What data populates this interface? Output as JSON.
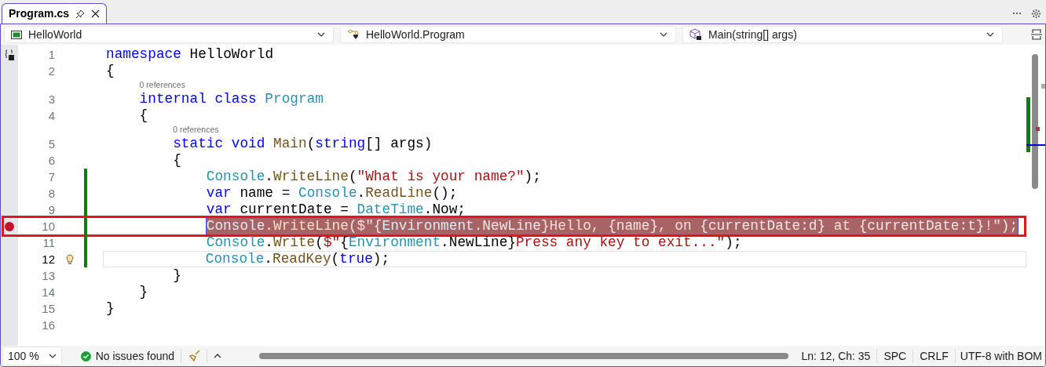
{
  "tab": {
    "title": "Program.cs",
    "selected": true
  },
  "nav": [
    {
      "kind": "project",
      "label": "HelloWorld"
    },
    {
      "kind": "class",
      "label": "HelloWorld.Program"
    },
    {
      "kind": "method",
      "label": "Main(string[] args)"
    }
  ],
  "lines": [
    {
      "number": "1",
      "breakpoint": false,
      "changed": false,
      "selected": false,
      "current": false,
      "framed": false,
      "lightbulb": false,
      "tokens": [
        {
          "kind": "keyword",
          "text": "namespace"
        },
        {
          "kind": "plain",
          "text": " HelloWorld"
        }
      ]
    },
    {
      "number": "2",
      "breakpoint": false,
      "changed": false,
      "selected": false,
      "current": false,
      "framed": false,
      "lightbulb": false,
      "tokens": [
        {
          "kind": "plain",
          "text": "{"
        }
      ]
    },
    {
      "number": "3",
      "codelens": "0 references",
      "breakpoint": false,
      "changed": false,
      "selected": false,
      "current": false,
      "framed": false,
      "lightbulb": false,
      "tokens": [
        {
          "kind": "keyword",
          "text": "    internal class"
        },
        {
          "kind": "type",
          "text": " Program"
        }
      ]
    },
    {
      "number": "4",
      "breakpoint": false,
      "changed": false,
      "selected": false,
      "current": false,
      "framed": false,
      "lightbulb": false,
      "tokens": [
        {
          "kind": "plain",
          "text": "    {"
        }
      ]
    },
    {
      "number": "5",
      "codelens": "0 references",
      "breakpoint": false,
      "changed": false,
      "selected": false,
      "current": false,
      "framed": false,
      "lightbulb": false,
      "tokens": [
        {
          "kind": "keyword",
          "text": "        static void"
        },
        {
          "kind": "method",
          "text": " Main"
        },
        {
          "kind": "plain",
          "text": "("
        },
        {
          "kind": "keyword",
          "text": "string"
        },
        {
          "kind": "plain",
          "text": "[] args)"
        }
      ]
    },
    {
      "number": "6",
      "breakpoint": false,
      "changed": false,
      "selected": false,
      "current": false,
      "framed": false,
      "lightbulb": false,
      "tokens": [
        {
          "kind": "plain",
          "text": "        {"
        }
      ]
    },
    {
      "number": "7",
      "breakpoint": false,
      "changed": true,
      "selected": false,
      "current": false,
      "framed": false,
      "lightbulb": false,
      "tokens": [
        {
          "kind": "type",
          "text": "            Console"
        },
        {
          "kind": "plain",
          "text": "."
        },
        {
          "kind": "method",
          "text": "WriteLine"
        },
        {
          "kind": "plain",
          "text": "("
        },
        {
          "kind": "string",
          "text": "\"What is your name?\""
        },
        {
          "kind": "plain",
          "text": ");"
        }
      ]
    },
    {
      "number": "8",
      "breakpoint": false,
      "changed": true,
      "selected": false,
      "current": false,
      "framed": false,
      "lightbulb": false,
      "tokens": [
        {
          "kind": "keyword",
          "text": "            var"
        },
        {
          "kind": "plain",
          "text": " name = "
        },
        {
          "kind": "type",
          "text": "Console"
        },
        {
          "kind": "plain",
          "text": "."
        },
        {
          "kind": "method",
          "text": "ReadLine"
        },
        {
          "kind": "plain",
          "text": "();"
        }
      ]
    },
    {
      "number": "9",
      "breakpoint": false,
      "changed": true,
      "selected": false,
      "current": false,
      "framed": false,
      "lightbulb": false,
      "tokens": [
        {
          "kind": "keyword",
          "text": "            var"
        },
        {
          "kind": "plain",
          "text": " currentDate = "
        },
        {
          "kind": "type",
          "text": "DateTime"
        },
        {
          "kind": "plain",
          "text": ".Now;"
        }
      ]
    },
    {
      "number": "10",
      "breakpoint": true,
      "changed": true,
      "selected": true,
      "current": false,
      "framed": true,
      "lightbulb": false,
      "tokens": [
        {
          "kind": "type",
          "text": "            Console"
        },
        {
          "kind": "plain",
          "text": "."
        },
        {
          "kind": "method",
          "text": "WriteLine"
        },
        {
          "kind": "plain",
          "text": "("
        },
        {
          "kind": "string",
          "text": "$\""
        },
        {
          "kind": "plain",
          "text": "{"
        },
        {
          "kind": "type",
          "text": "Environment"
        },
        {
          "kind": "plain",
          "text": ".NewLine}"
        },
        {
          "kind": "string",
          "text": "Hello, "
        },
        {
          "kind": "plain",
          "text": "{name}"
        },
        {
          "kind": "string",
          "text": ", on "
        },
        {
          "kind": "plain",
          "text": "{currentDate:d}"
        },
        {
          "kind": "string",
          "text": " at "
        },
        {
          "kind": "plain",
          "text": "{currentDate:t}"
        },
        {
          "kind": "string",
          "text": "!\""
        },
        {
          "kind": "plain",
          "text": ");"
        }
      ]
    },
    {
      "number": "11",
      "breakpoint": false,
      "changed": true,
      "selected": false,
      "current": false,
      "framed": false,
      "lightbulb": false,
      "tokens": [
        {
          "kind": "type",
          "text": "            Console"
        },
        {
          "kind": "plain",
          "text": "."
        },
        {
          "kind": "method",
          "text": "Write"
        },
        {
          "kind": "plain",
          "text": "("
        },
        {
          "kind": "string",
          "text": "$\""
        },
        {
          "kind": "plain",
          "text": "{"
        },
        {
          "kind": "type",
          "text": "Environment"
        },
        {
          "kind": "plain",
          "text": ".NewLine}"
        },
        {
          "kind": "string",
          "text": "Press any key to exit...\""
        },
        {
          "kind": "plain",
          "text": ");"
        }
      ]
    },
    {
      "number": "12",
      "breakpoint": false,
      "changed": true,
      "selected": false,
      "current": true,
      "framed": false,
      "lightbulb": true,
      "tokens": [
        {
          "kind": "type",
          "text": "            Console"
        },
        {
          "kind": "plain",
          "text": "."
        },
        {
          "kind": "method",
          "text": "ReadKey"
        },
        {
          "kind": "plain",
          "text": "("
        },
        {
          "kind": "keyword",
          "text": "true"
        },
        {
          "kind": "plain",
          "text": ");"
        }
      ]
    },
    {
      "number": "13",
      "breakpoint": false,
      "changed": false,
      "selected": false,
      "current": false,
      "framed": false,
      "lightbulb": false,
      "tokens": [
        {
          "kind": "plain",
          "text": "        }"
        }
      ]
    },
    {
      "number": "14",
      "breakpoint": false,
      "changed": false,
      "selected": false,
      "current": false,
      "framed": false,
      "lightbulb": false,
      "tokens": [
        {
          "kind": "plain",
          "text": "    }"
        }
      ]
    },
    {
      "number": "15",
      "breakpoint": false,
      "changed": false,
      "selected": false,
      "current": false,
      "framed": false,
      "lightbulb": false,
      "tokens": [
        {
          "kind": "plain",
          "text": "}"
        }
      ]
    },
    {
      "number": "16",
      "breakpoint": false,
      "changed": false,
      "selected": false,
      "current": false,
      "framed": false,
      "lightbulb": false
    }
  ],
  "status": {
    "zoom": "100 %",
    "issues": "No issues found",
    "position": "Ln: 12, Ch: 35",
    "indentation": "SPC",
    "line_ending": "CRLF",
    "encoding": "UTF-8 with BOM"
  }
}
